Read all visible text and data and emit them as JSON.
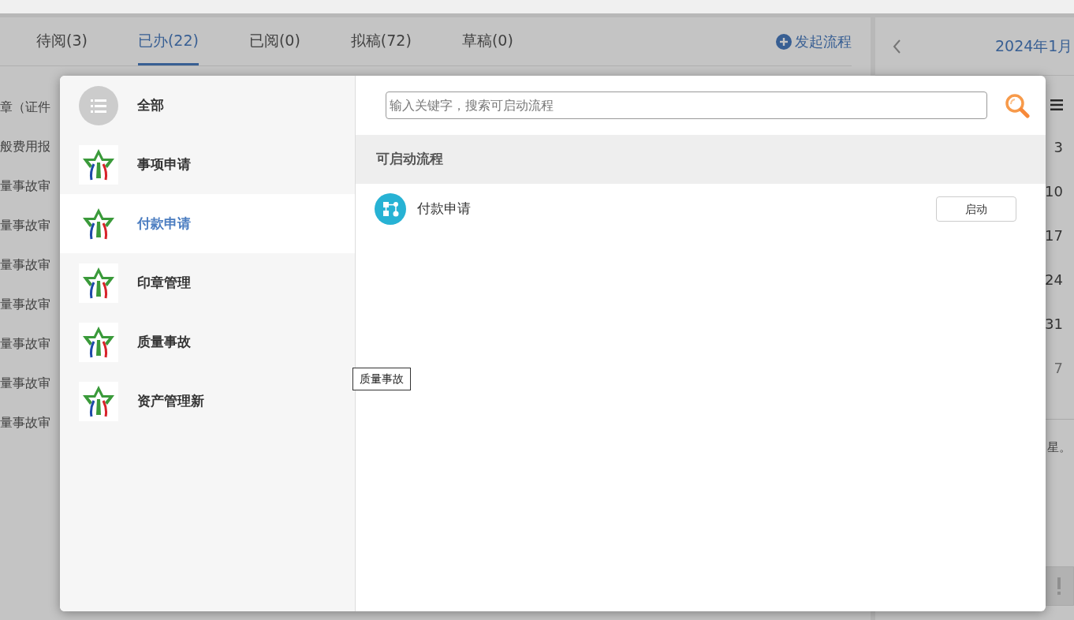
{
  "tabs": [
    {
      "label": "待阅(3)",
      "selected": false
    },
    {
      "label": "已办(22)",
      "selected": true
    },
    {
      "label": "已阅(0)",
      "selected": false
    },
    {
      "label": "拟稿(72)",
      "selected": false
    },
    {
      "label": "草稿(0)",
      "selected": false
    }
  ],
  "start_process_link": "发起流程",
  "background_list": [
    "章（证件",
    "般费用报",
    "量事故审",
    "量事故审",
    "量事故审",
    "量事故审",
    "量事故审",
    "量事故审",
    "量事故审"
  ],
  "calendar": {
    "month": "2024年1月",
    "dates": [
      {
        "label": "3",
        "muted": false
      },
      {
        "label": "10",
        "muted": false
      },
      {
        "label": "17",
        "muted": false
      },
      {
        "label": "24",
        "muted": false
      },
      {
        "label": "31",
        "muted": false
      },
      {
        "label": "7",
        "muted": true
      }
    ],
    "note": "星。"
  },
  "dialog": {
    "categories": [
      {
        "label": "全部",
        "kind": "all",
        "selected": false
      },
      {
        "label": "事项申请",
        "kind": "group",
        "selected": false
      },
      {
        "label": "付款申请",
        "kind": "group",
        "selected": true
      },
      {
        "label": "印章管理",
        "kind": "group",
        "selected": false
      },
      {
        "label": "质量事故",
        "kind": "group",
        "selected": false
      },
      {
        "label": "资产管理新",
        "kind": "group",
        "selected": false
      }
    ],
    "search": {
      "placeholder": "输入关键字，搜索可启动流程"
    },
    "section_title": "可启动流程",
    "processes": [
      {
        "name": "付款申请",
        "button": "启动"
      }
    ],
    "tooltip": "质量事故"
  }
}
